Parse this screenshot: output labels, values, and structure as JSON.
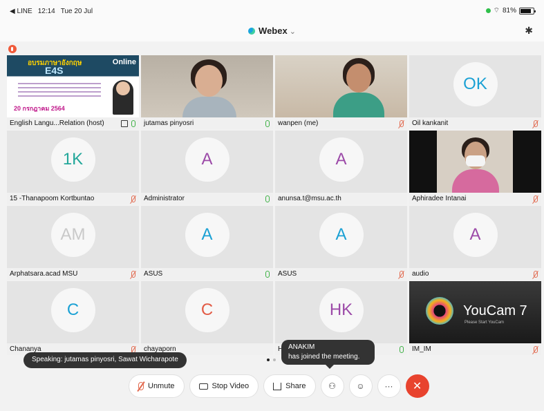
{
  "status_bar": {
    "back_app": "◀ LINE",
    "time": "12:14",
    "date": "Tue 20 Jul",
    "wifi_icon": "wifi-icon",
    "battery": "81%"
  },
  "header": {
    "title": "Webex",
    "title_chevron": "⌄",
    "bluetooth_icon": "bluetooth-icon"
  },
  "tiles": [
    {
      "name": "English Langu...Relation (host)",
      "mic": "on",
      "type": "slide",
      "sharing": true
    },
    {
      "name": "jutamas pinyosri",
      "mic": "on",
      "type": "video1",
      "active": true
    },
    {
      "name": "wanpen (me)",
      "mic": "off",
      "type": "video2"
    },
    {
      "name": "Oil kankanit",
      "mic": "off",
      "type": "avatar",
      "initials": "OK",
      "color": "#1ba1d4"
    },
    {
      "name": "15 -Thanapoom Kortbuntao",
      "mic": "off",
      "type": "avatar",
      "initials": "1K",
      "color": "#22a79a"
    },
    {
      "name": "Administrator",
      "mic": "on",
      "type": "avatar",
      "initials": "A",
      "color": "#9c4aa8"
    },
    {
      "name": "anunsa.t@msu.ac.th",
      "mic": "none",
      "type": "avatar",
      "initials": "A",
      "color": "#9c4aa8"
    },
    {
      "name": "Aphiradee Intanai",
      "mic": "off",
      "type": "video3"
    },
    {
      "name": "Arphatsara.acad MSU",
      "mic": "off",
      "type": "avatar",
      "initials": "AM",
      "color": "#c9c9c9"
    },
    {
      "name": "ASUS",
      "mic": "on",
      "type": "avatar",
      "initials": "A",
      "color": "#1ba1d4"
    },
    {
      "name": "ASUS",
      "mic": "off",
      "type": "avatar",
      "initials": "A",
      "color": "#1ba1d4"
    },
    {
      "name": "audio",
      "mic": "off",
      "type": "avatar",
      "initials": "A",
      "color": "#9c4aa8"
    },
    {
      "name": "Chananya",
      "mic": "off",
      "type": "avatar",
      "initials": "C",
      "color": "#1ba1d4"
    },
    {
      "name": "chayaporn",
      "mic": "none",
      "type": "avatar",
      "initials": "C",
      "color": "#e25b45"
    },
    {
      "name": "HR",
      "mic": "on",
      "type": "avatar",
      "initials": "HK",
      "color": "#9c4aa8"
    },
    {
      "name": "IM_IM",
      "mic": "off",
      "type": "youcam"
    }
  ],
  "slide": {
    "banner": "อบรมภาษาอังกฤษ",
    "online": "Online",
    "program": "E4S",
    "date": "20 กรกฎาคม 2564"
  },
  "youcam": {
    "brand": "YouCam 7",
    "sub": "Please Start YouCam"
  },
  "toasts": {
    "speaking": "Speaking: jutamas pinyosri, Sawat Wicharapote",
    "join_name": "ANAKIM",
    "join_msg": "has joined the meeting."
  },
  "controls": {
    "unmute": "Unmute",
    "stop_video": "Stop Video",
    "share": "Share",
    "participants_icon": "participants-icon",
    "reactions_icon": "emoji-icon",
    "more": "···",
    "end": "✕"
  }
}
